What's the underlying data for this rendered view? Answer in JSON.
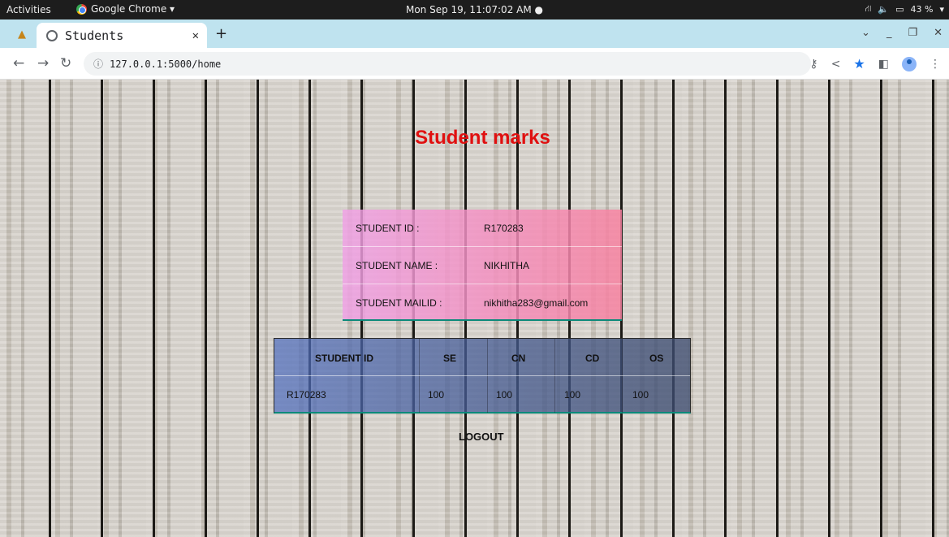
{
  "system_bar": {
    "activities": "Activities",
    "app_name": "Google Chrome ▾",
    "clock": "Mon Sep 19, 11:07:02 AM ●",
    "battery": "43 %"
  },
  "browser": {
    "tab_title": "Students",
    "url": "127.0.0.1:5000/home"
  },
  "page": {
    "heading": "Student marks",
    "student_info": [
      {
        "label": "STUDENT ID :",
        "value": "R170283"
      },
      {
        "label": "STUDENT NAME :",
        "value": "NIKHITHA"
      },
      {
        "label": "STUDENT MAILID :",
        "value": "nikhitha283@gmail.com"
      }
    ],
    "marks_table": {
      "headers": [
        "STUDENT ID",
        "SE",
        "CN",
        "CD",
        "OS"
      ],
      "rows": [
        [
          "R170283",
          "100",
          "100",
          "100",
          "100"
        ]
      ]
    },
    "logout_label": "LOGOUT"
  },
  "colors": {
    "heading": "#e01010",
    "accent_border": "#0b8a7a"
  }
}
